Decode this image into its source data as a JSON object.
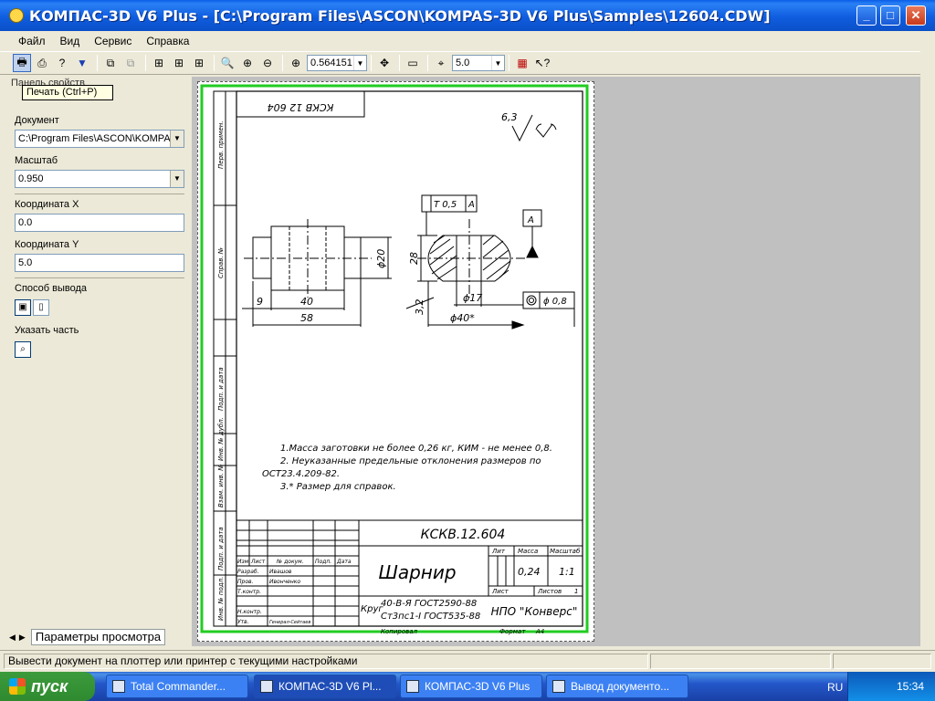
{
  "window": {
    "title": "КОМПАС-3D V6 Plus - [C:\\Program Files\\ASCON\\KOMPAS-3D V6 Plus\\Samples\\12604.CDW]",
    "min": "_",
    "max": "□",
    "close": "✕"
  },
  "menu": [
    "Файл",
    "Вид",
    "Сервис",
    "Справка"
  ],
  "toolbar": {
    "zoom_value": "0.564151",
    "step_value": "5.0"
  },
  "panel": {
    "title": "Панель свойств",
    "tooltip": "Печать (Ctrl+P)",
    "document_label": "Документ",
    "document_value": "C:\\Program Files\\ASCON\\KOMPA",
    "scale_label": "Масштаб",
    "scale_value": "0.950",
    "coord_x_label": "Координата X",
    "coord_x_value": "0.0",
    "coord_y_label": "Координата Y",
    "coord_y_value": "5.0",
    "output_label": "Способ вывода",
    "part_label": "Указать часть",
    "tab_label": "Параметры просмотра"
  },
  "drawing": {
    "stamp_code": "КСКВ.12.604",
    "stamp_code_flipped": "КСКВ 12 604",
    "roughness": "6,3",
    "flatness_tol": "T 0,5",
    "datum": "A",
    "datum_ref": "A",
    "concentric_tol": "ϕ 0,8",
    "dims": {
      "d20": "ϕ20",
      "d28": "28",
      "d17": "ϕ17",
      "d40": "ϕ40*",
      "l9": "9",
      "l40": "40",
      "l58": "58",
      "c32": "3,2"
    },
    "notes": [
      "1.Масса заготовки не более 0,26 кг, КИМ - не менее 0,8.",
      "2. Неуказанные предельные отклонения размеров по",
      "ОСТ23.4.209-82.",
      "3.* Размер для справок."
    ],
    "title_name": "Шарнир",
    "material_1": "40-В-Я ГОСТ2590-88",
    "material_prefix": "Круг",
    "material_2": "Ст3пс1-I ГОСТ535-88",
    "organization": "НПО \"Конверс\"",
    "mass": "0,24",
    "scale": "1:1",
    "col_lit": "Лит",
    "col_mass": "Масса",
    "col_scale": "Масштаб",
    "sheet_label": "Лист",
    "sheets_label": "Листов",
    "sheets_count": "1",
    "format": "Формат",
    "format_value": "А4",
    "copied": "Копировал",
    "sign_rows": [
      "Изм.",
      "Лист",
      "№ докум.",
      "Подп.",
      "Дата"
    ],
    "people": [
      {
        "role": "Разраб.",
        "name": "Ивашов"
      },
      {
        "role": "Пров.",
        "name": "Ивонченко"
      },
      {
        "role": "Т.контр.",
        "name": ""
      },
      {
        "role": "Н.контр.",
        "name": ""
      },
      {
        "role": "Утв.",
        "name": "Генерал-Сейтаев"
      }
    ],
    "side_labels": [
      "Перв. примен.",
      "Справ. №",
      "Подп. и дата",
      "Инв. № дубл.",
      "Взам. инв. №",
      "Подп. и дата",
      "Инв. № подл."
    ]
  },
  "status": {
    "message": "Вывести документ на плоттер или принтер с текущими настройками"
  },
  "taskbar": {
    "start": "пуск",
    "tasks": [
      "Total Commander...",
      "КОМПАС-3D V6 Pl...",
      "КОМПАС-3D V6 Plus",
      "Вывод документо..."
    ],
    "lang": "RU",
    "clock": "15:34"
  },
  "colors": {
    "sheet_border": "#22cc22",
    "titlebar": "#0a5ee8",
    "workspace": "#c0c0c0"
  }
}
